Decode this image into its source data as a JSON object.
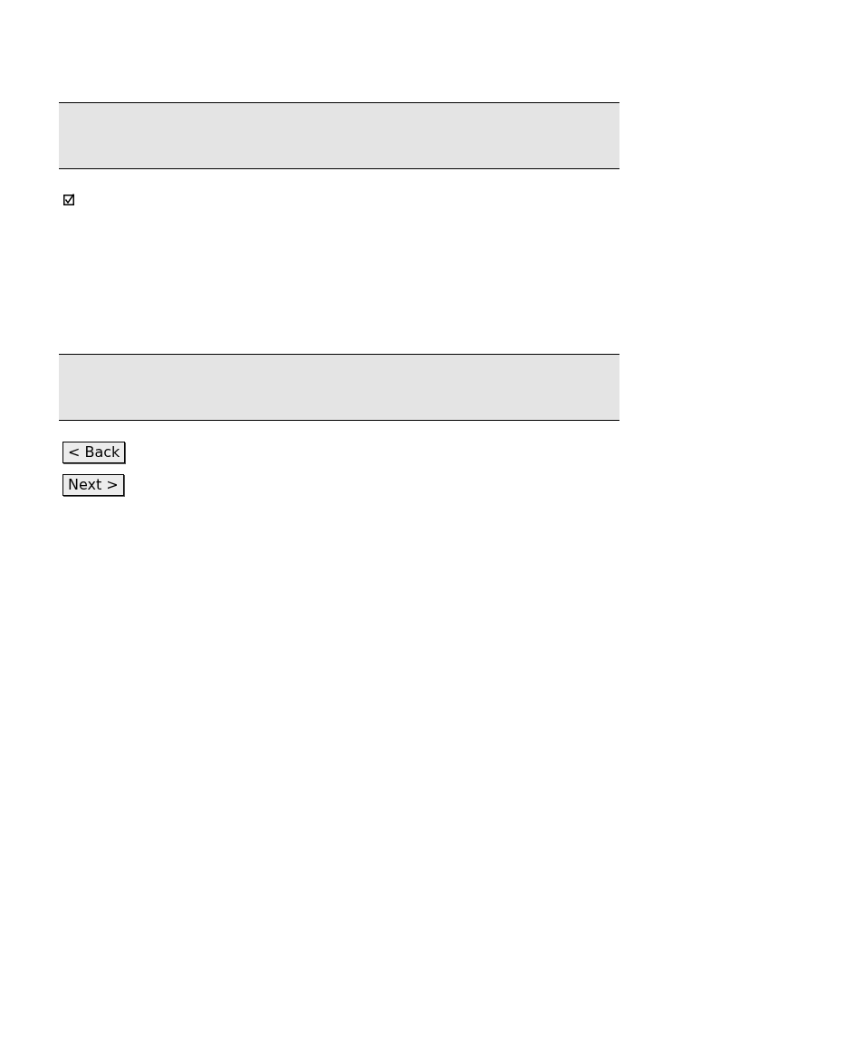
{
  "checkbox": {
    "checked": true
  },
  "buttons": [
    {
      "label": "< Back"
    },
    {
      "label": "Next >"
    }
  ]
}
